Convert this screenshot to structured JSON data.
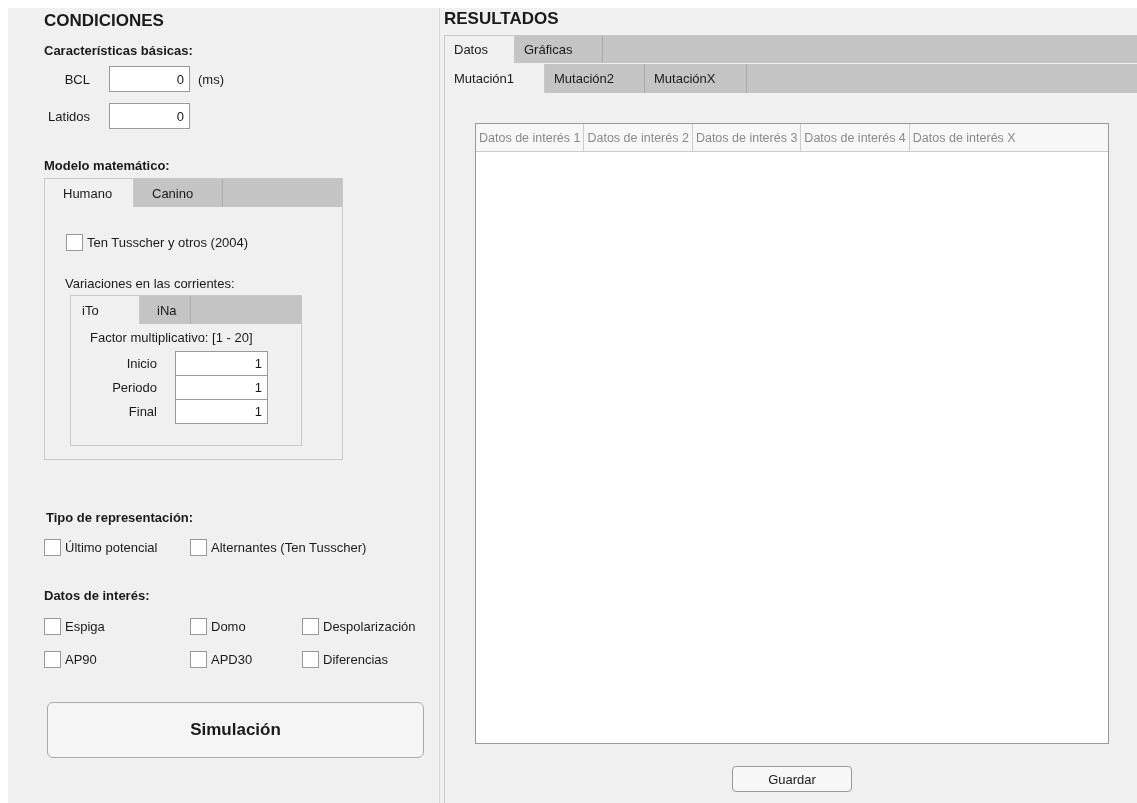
{
  "conditions": {
    "title": "CONDICIONES",
    "basic": {
      "heading": "Características básicas:",
      "fields": [
        {
          "label": "BCL",
          "value": "0",
          "unit": "(ms)"
        },
        {
          "label": "Latidos",
          "value": "0"
        }
      ]
    },
    "model": {
      "heading": "Modelo matemático:",
      "tabs": [
        {
          "label": "Humano",
          "selected": true
        },
        {
          "label": "Canino",
          "selected": false
        }
      ],
      "checkbox": {
        "label": "Ten Tusscher y otros (2004)",
        "checked": false
      },
      "currents": {
        "heading": "Variaciones en las corrientes:",
        "tabs": [
          {
            "label": "iTo",
            "selected": true
          },
          {
            "label": "iNa",
            "selected": false
          }
        ],
        "factor_label": "Factor multiplicativo: [1 - 20]",
        "fields": [
          {
            "label": "Inicio",
            "value": "1"
          },
          {
            "label": "Periodo",
            "value": "1"
          },
          {
            "label": "Final",
            "value": "1"
          }
        ]
      }
    },
    "representation": {
      "heading": "Tipo de representación:",
      "options": [
        {
          "label": "Último potencial",
          "checked": false
        },
        {
          "label": "Alternantes (Ten Tusscher)",
          "checked": false
        }
      ]
    },
    "interest": {
      "heading": "Datos de interés:",
      "options": [
        {
          "label": "Espiga",
          "checked": false
        },
        {
          "label": "Domo",
          "checked": false
        },
        {
          "label": "Despolarización",
          "checked": false
        },
        {
          "label": "AP90",
          "checked": false
        },
        {
          "label": "APD30",
          "checked": false
        },
        {
          "label": "Diferencias",
          "checked": false
        }
      ]
    },
    "simulate_button": "Simulación"
  },
  "results": {
    "title": "RESULTADOS",
    "tabs": [
      {
        "label": "Datos",
        "selected": true
      },
      {
        "label": "Gráficas",
        "selected": false
      }
    ],
    "subtabs": [
      {
        "label": "Mutación1",
        "selected": true
      },
      {
        "label": "Mutación2",
        "selected": false
      },
      {
        "label": "MutaciónX",
        "selected": false
      }
    ],
    "table": {
      "columns": [
        "Datos de interés 1",
        "Datos de interés 2",
        "Datos de interés 3",
        "Datos de interés 4",
        "Datos de interés X"
      ]
    },
    "save_button": "Guardar"
  }
}
